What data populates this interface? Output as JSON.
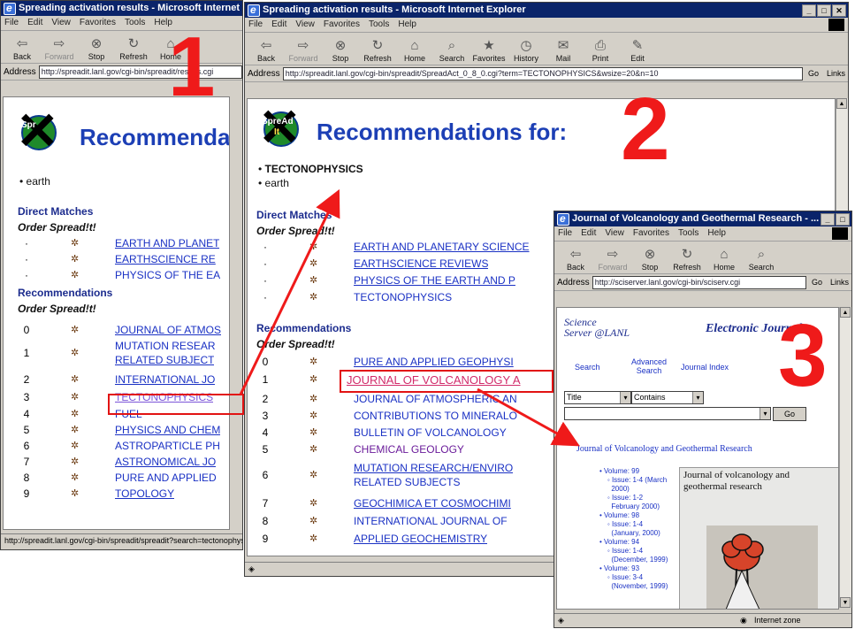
{
  "window1": {
    "title": "Spreading activation results - Microsoft Internet",
    "menu": [
      "File",
      "Edit",
      "View",
      "Favorites",
      "Tools",
      "Help"
    ],
    "toolbar": [
      {
        "label": "Back",
        "icon": "back-arrow-icon"
      },
      {
        "label": "Forward",
        "icon": "forward-arrow-icon"
      },
      {
        "label": "Stop",
        "icon": "stop-icon"
      },
      {
        "label": "Refresh",
        "icon": "refresh-icon"
      },
      {
        "label": "Home",
        "icon": "home-icon"
      }
    ],
    "address_label": "Address",
    "address_value": "http://spreadit.lanl.gov/cgi-bin/spreadit/results.cgi",
    "heading": "Recommenda",
    "query_terms": [
      "earth"
    ],
    "direct_matches_label": "Direct Matches",
    "order_label": "Order Spread!t!",
    "direct_matches": [
      {
        "n": "",
        "title": "EARTH AND PLANET"
      },
      {
        "n": "",
        "title": "EARTHSCIENCE RE"
      },
      {
        "n": "",
        "title": "PHYSICS OF THE EA"
      }
    ],
    "recommendations_label": "Recommendations",
    "recommendations": [
      {
        "n": "0",
        "title": "JOURNAL OF ATMOS"
      },
      {
        "n": "1",
        "title": "MUTATION RESEAR",
        "title2": "RELATED SUBJECT"
      },
      {
        "n": "2",
        "title": "INTERNATIONAL JO"
      },
      {
        "n": "3",
        "title": "TECTONOPHYSICS"
      },
      {
        "n": "4",
        "title": "FUEL"
      },
      {
        "n": "5",
        "title": "PHYSICS AND CHEM"
      },
      {
        "n": "6",
        "title": "ASTROPARTICLE PH"
      },
      {
        "n": "7",
        "title": "ASTRONOMICAL JO"
      },
      {
        "n": "8",
        "title": "PURE AND APPLIED"
      },
      {
        "n": "9",
        "title": "TOPOLOGY"
      }
    ],
    "status": "http://spreadit.lanl.gov/cgi-bin/spreadit/spreadit?search=tectonophysics",
    "step_number": "1"
  },
  "window2": {
    "title": "Spreading activation results - Microsoft Internet Explorer",
    "menu": [
      "File",
      "Edit",
      "View",
      "Favorites",
      "Tools",
      "Help"
    ],
    "toolbar": [
      {
        "label": "Back",
        "icon": "back-arrow-icon"
      },
      {
        "label": "Forward",
        "icon": "forward-arrow-icon"
      },
      {
        "label": "Stop",
        "icon": "stop-icon"
      },
      {
        "label": "Refresh",
        "icon": "refresh-icon"
      },
      {
        "label": "Home",
        "icon": "home-icon"
      },
      {
        "label": "Search",
        "icon": "search-icon"
      },
      {
        "label": "Favorites",
        "icon": "favorites-icon"
      },
      {
        "label": "History",
        "icon": "history-icon"
      },
      {
        "label": "Mail",
        "icon": "mail-icon"
      },
      {
        "label": "Print",
        "icon": "print-icon"
      },
      {
        "label": "Edit",
        "icon": "edit-icon"
      }
    ],
    "address_label": "Address",
    "address_value": "http://spreadit.lanl.gov/cgi-bin/spreadit/SpreadAct_0_8_0.cgi?term=TECTONOPHYSICS&wsize=20&n=10",
    "go_label": "Go",
    "links_label": "Links",
    "heading": "Recommendations for:",
    "query_terms": [
      "TECTONOPHYSICS",
      "earth"
    ],
    "direct_matches_label": "Direct Matches",
    "order_label": "Order Spread!t!",
    "direct_matches": [
      {
        "n": "",
        "title": "EARTH AND PLANETARY SCIENCE"
      },
      {
        "n": "",
        "title": "EARTHSCIENCE REVIEWS"
      },
      {
        "n": "",
        "title": "PHYSICS OF THE EARTH AND P"
      },
      {
        "n": "",
        "title": "TECTONOPHYSICS"
      }
    ],
    "recommendations_label": "Recommendations",
    "recommendations": [
      {
        "n": "0",
        "title": "PURE AND APPLIED GEOPHYSI"
      },
      {
        "n": "1",
        "title": "JOURNAL OF VOLCANOLOGY A"
      },
      {
        "n": "2",
        "title": "JOURNAL OF ATMOSPHERIC AN"
      },
      {
        "n": "3",
        "title": "CONTRIBUTIONS TO MINERALO"
      },
      {
        "n": "4",
        "title": "BULLETIN OF VOLCANOLOGY"
      },
      {
        "n": "5",
        "title": "CHEMICAL GEOLOGY"
      },
      {
        "n": "6",
        "title": "MUTATION RESEARCH/ENVIRO",
        "title2": "RELATED SUBJECTS"
      },
      {
        "n": "7",
        "title": "GEOCHIMICA ET COSMOCHIMI"
      },
      {
        "n": "8",
        "title": "INTERNATIONAL JOURNAL OF"
      },
      {
        "n": "9",
        "title": "APPLIED GEOCHEMISTRY"
      }
    ],
    "status": "",
    "step_number": "2"
  },
  "window3": {
    "title": "Journal of Volcanology and Geothermal Research - ...",
    "menu": [
      "File",
      "Edit",
      "View",
      "Favorites",
      "Tools",
      "Help"
    ],
    "toolbar": [
      {
        "label": "Back",
        "icon": "back-arrow-icon"
      },
      {
        "label": "Forward",
        "icon": "forward-arrow-icon"
      },
      {
        "label": "Stop",
        "icon": "stop-icon"
      },
      {
        "label": "Refresh",
        "icon": "refresh-icon"
      },
      {
        "label": "Home",
        "icon": "home-icon"
      },
      {
        "label": "Search",
        "icon": "search-icon"
      }
    ],
    "address_label": "Address",
    "address_value": "http://sciserver.lanl.gov/cgi-bin/sciserv.cgi",
    "go_label": "Go",
    "links_label": "Links",
    "site_logo_top": "Science",
    "site_logo_bottom": "Server @LANL",
    "site_section": "Electronic Journals",
    "nav": [
      "Search",
      "Advanced Search",
      "Journal Index"
    ],
    "select1": "Title",
    "select2": "Contains",
    "search_value": "",
    "go_button": "Go",
    "journal_title": "Journal of Volcanology and Geothermal Research",
    "volumes": [
      {
        "volume": "Volume: 99",
        "issue": "Issue: 1-4 (March",
        "date": "2000)"
      },
      {
        "volume": "",
        "issue": "Issue: 1-2",
        "date": "February 2000)"
      },
      {
        "volume": "Volume: 98",
        "issue": "Issue: 1-4",
        "date": "(January, 2000)"
      },
      {
        "volume": "Volume: 94",
        "issue": "Issue: 1-4",
        "date": "(December, 1999)"
      },
      {
        "volume": "Volume: 93",
        "issue": "Issue: 3-4",
        "date": "(November, 1999)"
      }
    ],
    "cover_title": "Journal of volcanology and geothermal research",
    "status": "",
    "zone_label": "Internet zone",
    "step_number": "3"
  },
  "colors": {
    "accent_red": "#ef1a1a",
    "link_blue": "#1a31c4",
    "title_bar": "#0a246a",
    "heading_blue": "#1c3fb5"
  }
}
